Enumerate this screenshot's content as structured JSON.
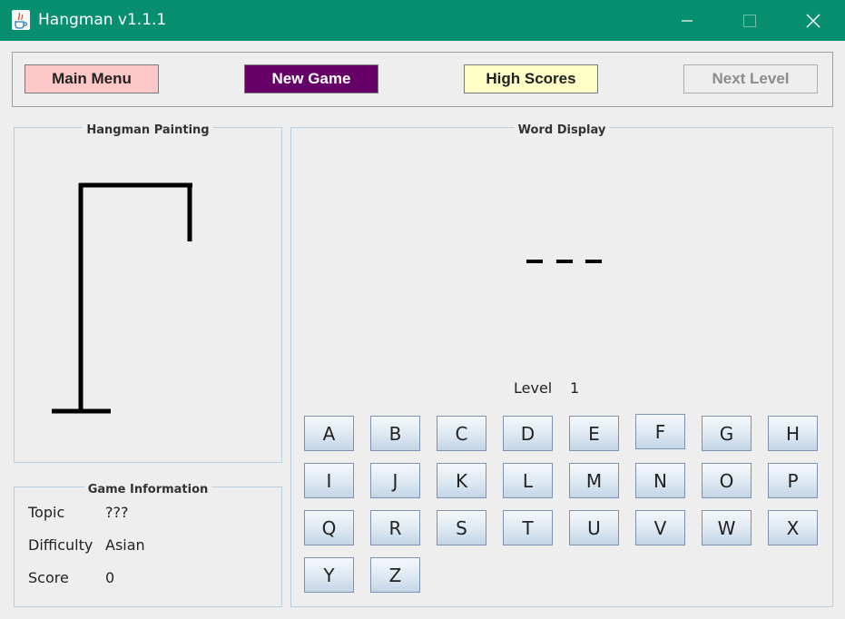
{
  "window": {
    "title": "Hangman v1.1.1",
    "app_icon": "java-cup-icon",
    "controls": [
      "minimize-icon",
      "maximize-icon",
      "close-icon"
    ]
  },
  "toolbar": {
    "main_menu": {
      "label": "Main Menu",
      "bg": "#ffc8c8",
      "color": "#222222"
    },
    "new_game": {
      "label": "New Game",
      "bg": "#660066",
      "color": "#ffffff"
    },
    "high_scores": {
      "label": "High Scores",
      "bg": "#ffffc8",
      "color": "#222222"
    },
    "next_level": {
      "label": "Next Level",
      "bg": "#eeeeee",
      "color": "#8c8c8c",
      "enabled": false
    }
  },
  "hangman_panel": {
    "title": "Hangman Painting",
    "incorrect_guesses": 0
  },
  "info_panel": {
    "title": "Game Information",
    "rows": [
      {
        "label": "Topic",
        "value": "???"
      },
      {
        "label": "Difficulty",
        "value": "Asian"
      },
      {
        "label": "Score",
        "value": "0"
      }
    ]
  },
  "word_panel": {
    "title": "Word Display",
    "word_blanks": "_ _ _",
    "word_length": 3,
    "level_label": "Level",
    "level_value": "1"
  },
  "letters": [
    "A",
    "B",
    "C",
    "D",
    "E",
    "F",
    "G",
    "H",
    "I",
    "J",
    "K",
    "L",
    "M",
    "N",
    "O",
    "P",
    "Q",
    "R",
    "S",
    "T",
    "U",
    "V",
    "W",
    "X",
    "Y",
    "Z"
  ],
  "colors": {
    "titlebar": "#078f70",
    "panel_border": "#b8cfe0",
    "background": "#eeeeee"
  }
}
